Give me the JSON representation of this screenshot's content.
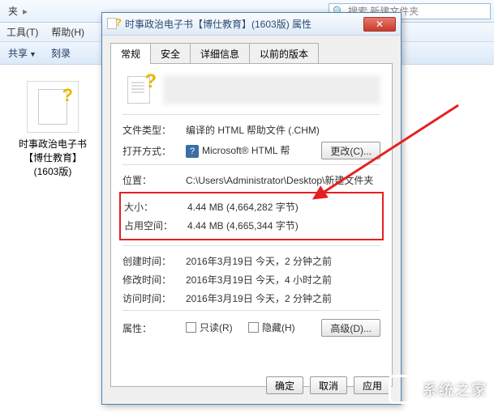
{
  "explorer": {
    "breadcrumb_seg": "夹",
    "search_placeholder": "搜索 新建文件夹",
    "menu": {
      "tools": "工具(T)",
      "help": "帮助(H)"
    },
    "toolbar": {
      "share": "共享",
      "burn": "刻录"
    },
    "file": {
      "name": "时事政治电子书【博仕教育】(1603版)"
    }
  },
  "dialog": {
    "title": "时事政治电子书【博仕教育】(1603版) 属性",
    "tabs": {
      "general": "常规",
      "security": "安全",
      "details": "详细信息",
      "previous": "以前的版本"
    },
    "labels": {
      "file_type": "文件类型：",
      "opens_with": "打开方式：",
      "location": "位置：",
      "size": "大小：",
      "size_on_disk": "占用空间：",
      "created": "创建时间：",
      "modified": "修改时间：",
      "accessed": "访问时间：",
      "attributes": "属性："
    },
    "values": {
      "file_type": "编译的 HTML 帮助文件 (.CHM)",
      "opens_with": "Microsoft® HTML 帮",
      "location": "C:\\Users\\Administrator\\Desktop\\新建文件夹",
      "size": "4.44 MB (4,664,282 字节)",
      "size_on_disk": "4.44 MB (4,665,344 字节)",
      "created": "2016年3月19日 今天，2 分钟之前",
      "modified": "2016年3月19日 今天，4 小时之前",
      "accessed": "2016年3月19日 今天，2 分钟之前"
    },
    "buttons": {
      "change": "更改(C)...",
      "advanced": "高级(D)...",
      "ok": "确定",
      "cancel": "取消",
      "apply": "应用"
    },
    "attributes": {
      "readonly": "只读(R)",
      "hidden": "隐藏(H)"
    }
  },
  "watermark": "系统之家"
}
